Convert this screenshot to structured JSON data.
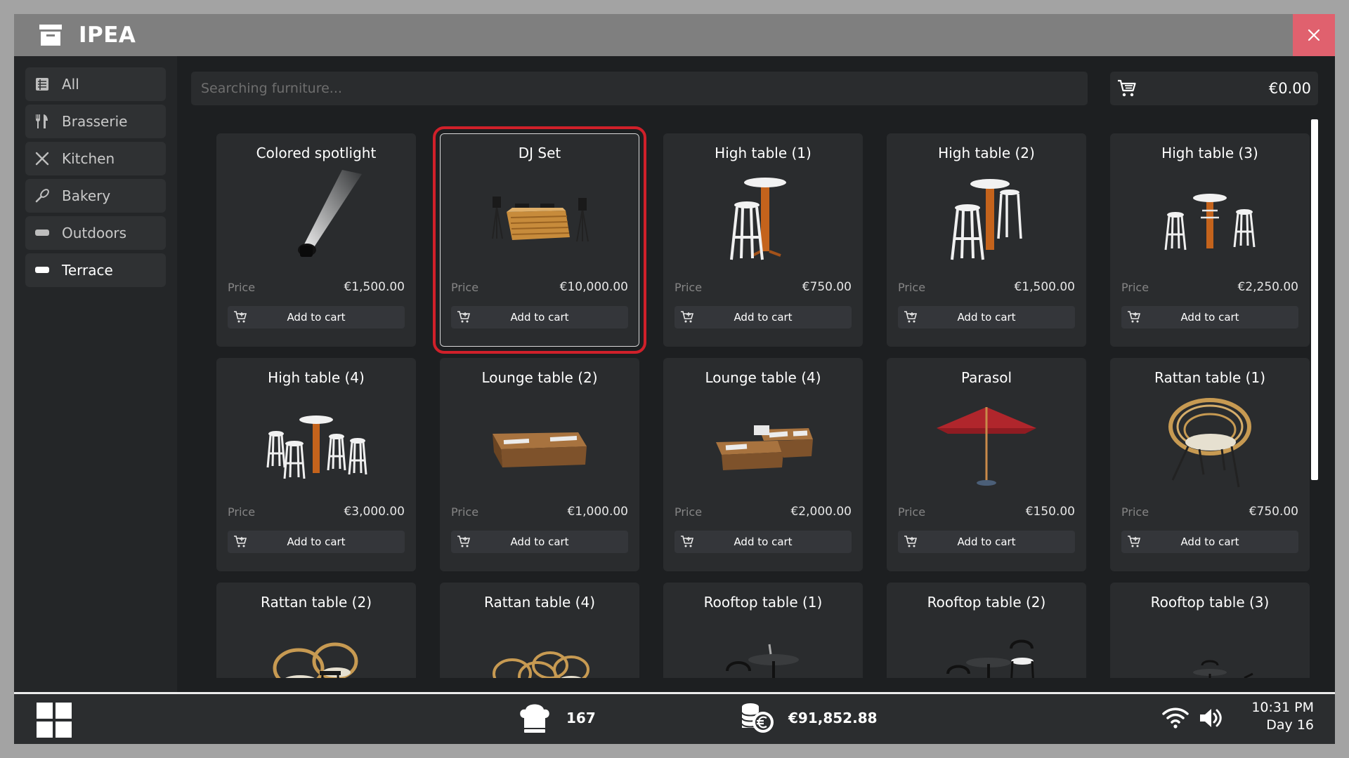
{
  "app": {
    "title": "IPEA"
  },
  "colors": {
    "close_button": "#e0616e",
    "selection_outline": "#d0202a",
    "accent": "#ffffff"
  },
  "sidebar": {
    "items": [
      {
        "label": "All",
        "icon": "list-icon",
        "active": false
      },
      {
        "label": "Brasserie",
        "icon": "fork-knife-icon",
        "active": false
      },
      {
        "label": "Kitchen",
        "icon": "kitchen-utensils-icon",
        "active": false
      },
      {
        "label": "Bakery",
        "icon": "whisk-icon",
        "active": false
      },
      {
        "label": "Outdoors",
        "icon": "bench-icon",
        "active": false
      },
      {
        "label": "Terrace",
        "icon": "bench-icon",
        "active": true
      }
    ]
  },
  "search": {
    "placeholder": "Searching furniture..."
  },
  "cart": {
    "total": "€0.00",
    "icon": "cart-icon"
  },
  "products": {
    "price_label": "Price",
    "add_label": "Add to cart",
    "items": [
      {
        "name": "Colored spotlight",
        "price": "€1,500.00",
        "image": "spotlight"
      },
      {
        "name": "DJ Set",
        "price": "€10,000.00",
        "image": "dj-set",
        "selected": true
      },
      {
        "name": "High table (1)",
        "price": "€750.00",
        "image": "high-table-1"
      },
      {
        "name": "High table (2)",
        "price": "€1,500.00",
        "image": "high-table-2"
      },
      {
        "name": "High table (3)",
        "price": "€2,250.00",
        "image": "high-table-3"
      },
      {
        "name": "High table (4)",
        "price": "€3,000.00",
        "image": "high-table-4"
      },
      {
        "name": "Lounge table (2)",
        "price": "€1,000.00",
        "image": "lounge-2"
      },
      {
        "name": "Lounge table (4)",
        "price": "€2,000.00",
        "image": "lounge-4"
      },
      {
        "name": "Parasol",
        "price": "€150.00",
        "image": "parasol"
      },
      {
        "name": "Rattan table (1)",
        "price": "€750.00",
        "image": "rattan-1"
      },
      {
        "name": "Rattan table (2)",
        "price": "",
        "image": "rattan-2"
      },
      {
        "name": "Rattan table (4)",
        "price": "",
        "image": "rattan-4"
      },
      {
        "name": "Rooftop table (1)",
        "price": "",
        "image": "rooftop-1"
      },
      {
        "name": "Rooftop table (2)",
        "price": "",
        "image": "rooftop-2"
      },
      {
        "name": "Rooftop table (3)",
        "price": "",
        "image": "rooftop-3"
      }
    ]
  },
  "taskbar": {
    "chefs": "167",
    "money": "€91,852.88",
    "time": "10:31 PM",
    "day": "Day 16"
  }
}
